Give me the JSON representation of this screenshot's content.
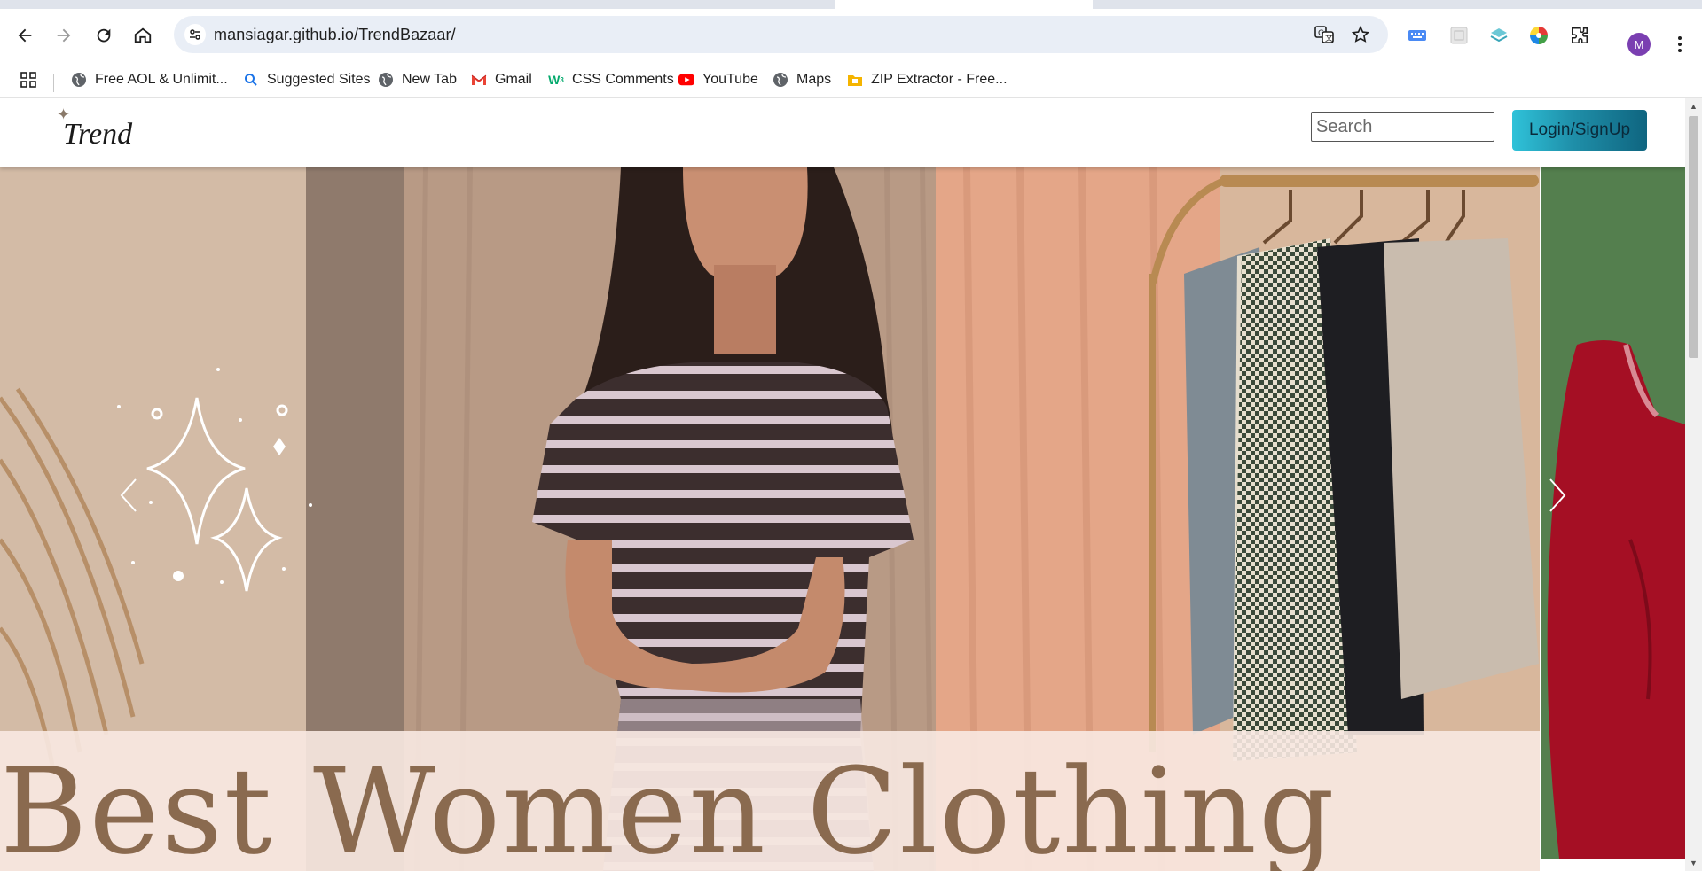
{
  "browser": {
    "url": "mansiagar.github.io/TrendBazaar/",
    "profile_initial": "M",
    "bookmarks": [
      {
        "label": "Free AOL & Unlimit...",
        "icon": "globe-icon"
      },
      {
        "label": "Suggested Sites",
        "icon": "search-icon"
      },
      {
        "label": "New Tab",
        "icon": "globe-icon"
      },
      {
        "label": "Gmail",
        "icon": "gmail-icon"
      },
      {
        "label": "CSS Comments",
        "icon": "w3-icon"
      },
      {
        "label": "YouTube",
        "icon": "youtube-icon"
      },
      {
        "label": "Maps",
        "icon": "globe-icon"
      },
      {
        "label": "ZIP Extractor - Free...",
        "icon": "zip-icon"
      }
    ]
  },
  "site": {
    "logo_text": "Trend",
    "search_placeholder": "Search",
    "login_label": "Login/SignUp",
    "hero_banner_text": "Best Women Clothing"
  },
  "colors": {
    "login_gradient_start": "#2fc2d9",
    "login_gradient_end": "#0f6580",
    "banner_text": "#8a6a4f",
    "banner_bg": "#f8e9e2",
    "avatar": "#7a3fb1"
  }
}
